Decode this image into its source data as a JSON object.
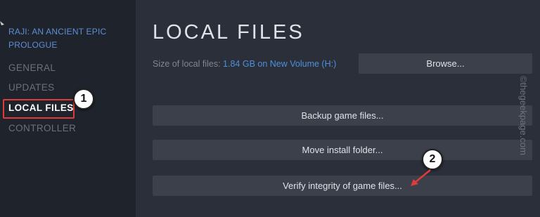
{
  "sidebar": {
    "game_title": "RAJI: AN ANCIENT EPIC PROLOGUE",
    "items": [
      {
        "label": "GENERAL"
      },
      {
        "label": "UPDATES"
      },
      {
        "label": "LOCAL FILES"
      },
      {
        "label": "CONTROLLER"
      }
    ]
  },
  "main": {
    "heading": "LOCAL FILES",
    "size_label": "Size of local files: ",
    "size_value": "1.84 GB on New Volume (H:)",
    "browse_label": "Browse...",
    "backup_label": "Backup game files...",
    "move_label": "Move install folder...",
    "verify_label": "Verify integrity of game files..."
  },
  "annotations": {
    "badge1": "1",
    "badge2": "2",
    "highlight_color": "#e03a3a"
  },
  "watermark": "©thegeekpage.com",
  "colors": {
    "accent": "#4e90d9",
    "sidebar_bg": "#1f232b",
    "main_bg": "#2a2f3a",
    "button_bg": "#3b404b"
  }
}
